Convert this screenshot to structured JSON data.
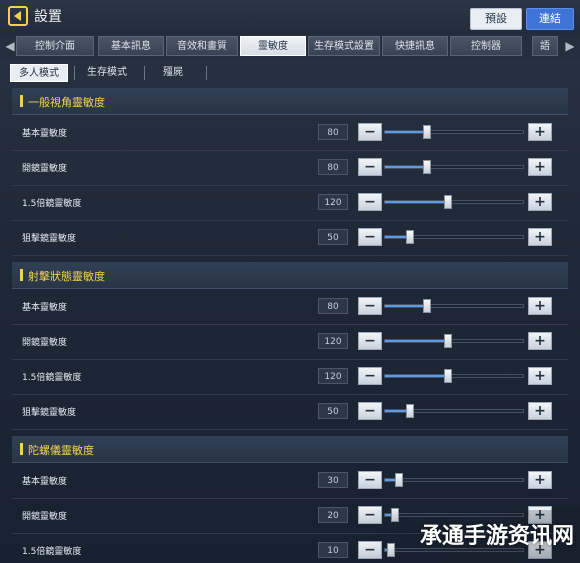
{
  "header": {
    "title": "設置",
    "preset_label": "預設",
    "connect_label": "連結"
  },
  "tabs": [
    {
      "label": "控制介面"
    },
    {
      "label": "基本訊息"
    },
    {
      "label": "音效和畫質"
    },
    {
      "label": "靈敏度",
      "active": true
    },
    {
      "label": "生存模式設置"
    },
    {
      "label": "快捷訊息"
    },
    {
      "label": "控制器"
    },
    {
      "label": "語"
    }
  ],
  "subtabs": [
    {
      "label": "多人模式",
      "active": true
    },
    {
      "label": "生存模式"
    },
    {
      "label": "殭屍"
    }
  ],
  "sections": [
    {
      "title": "一般視角靈敏度",
      "rows": [
        {
          "label": "基本靈敏度",
          "value": "80",
          "level": 0.3
        },
        {
          "label": "開鏡靈敏度",
          "value": "80",
          "level": 0.3
        },
        {
          "label": "1.5倍鏡靈敏度",
          "value": "120",
          "level": 0.45
        },
        {
          "label": "狙擊鏡靈敏度",
          "value": "50",
          "level": 0.18
        }
      ]
    },
    {
      "title": "射擊狀態靈敏度",
      "rows": [
        {
          "label": "基本靈敏度",
          "value": "80",
          "level": 0.3
        },
        {
          "label": "開鏡靈敏度",
          "value": "120",
          "level": 0.45
        },
        {
          "label": "1.5倍鏡靈敏度",
          "value": "120",
          "level": 0.45
        },
        {
          "label": "狙擊鏡靈敏度",
          "value": "50",
          "level": 0.18
        }
      ]
    },
    {
      "title": "陀螺儀靈敏度",
      "rows": [
        {
          "label": "基本靈敏度",
          "value": "30",
          "level": 0.1
        },
        {
          "label": "開鏡靈敏度",
          "value": "20",
          "level": 0.07
        },
        {
          "label": "1.5倍鏡靈敏度",
          "value": "10",
          "level": 0.04
        }
      ]
    }
  ],
  "watermark": "承通手游资讯网",
  "icons": {
    "back": "back-arrow-icon",
    "prev": "chevron-left-icon",
    "next": "chevron-right-icon"
  },
  "colors": {
    "accent": "#f2d24a",
    "fill": "#5b9be8",
    "connect": "#3f74d6"
  }
}
